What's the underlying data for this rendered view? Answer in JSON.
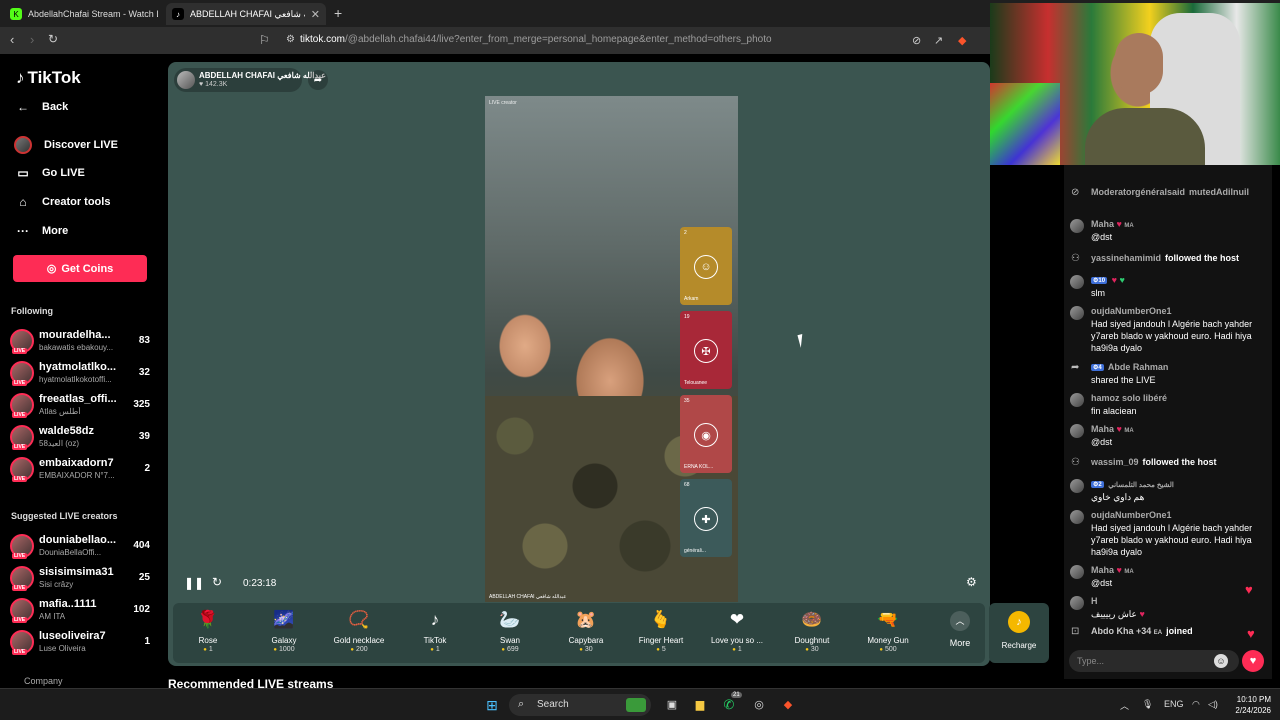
{
  "browser": {
    "tabs": [
      {
        "title": "AbdellahChafai Stream - Watch Live",
        "favicon": "kick-icon",
        "color": "#53fc18"
      },
      {
        "title": "ABDELLAH CHAFAI عبدالله شافعي",
        "favicon": "tiktok-icon",
        "color": "#111111"
      }
    ],
    "url_host": "tiktok.com",
    "url_rest": "/@abdellah.chafai44/live?enter_from_merge=personal_homepage&enter_method=others_photo"
  },
  "sidebar": {
    "logo": "TikTok",
    "nav": [
      {
        "label": "Back",
        "icon": "arrow-left-icon"
      },
      {
        "label": "Discover LIVE",
        "icon": "avatar"
      },
      {
        "label": "Go LIVE",
        "icon": "camera-icon"
      },
      {
        "label": "Creator tools",
        "icon": "home-icon"
      },
      {
        "label": "More",
        "icon": "ellipsis-icon"
      }
    ],
    "coins_button": "Get Coins",
    "following_heading": "Following",
    "following": [
      {
        "name": "mouradelha...",
        "sub": "bakawatis ebakouy...",
        "count": "83"
      },
      {
        "name": "hyatmolatlko...",
        "sub": "hyatmolatlkokotoffi...",
        "count": "32"
      },
      {
        "name": "freeatlas_offi...",
        "sub": "Atlas أطلس",
        "count": "325"
      },
      {
        "name": "walde58dz",
        "sub": "58العيد (oz)",
        "count": "39"
      },
      {
        "name": "embaixadorn7",
        "sub": "EMBAIXADOR N°7...",
        "count": "2"
      }
    ],
    "suggested_heading": "Suggested LIVE creators",
    "suggested": [
      {
        "name": "douniabellao...",
        "sub": "DouniaBellaOffi...",
        "count": "404"
      },
      {
        "name": "sisisimsima31",
        "sub": "Sisi crâzy",
        "count": "25"
      },
      {
        "name": "mafia..1111",
        "sub": "AM ITA",
        "count": "102"
      },
      {
        "name": "luseoliveira7",
        "sub": "Luse Oliveira",
        "count": "1"
      }
    ],
    "live_badge": "LIVE",
    "company": "Company"
  },
  "player": {
    "host_name": "ABDELLAH CHAFAI عبدالله شافعي",
    "host_likes": "142.3K",
    "video_label": "LIVE creator",
    "video_caption": "ABDELLAH CHAFAI عبدالله شافعي",
    "guests": [
      {
        "count": "2",
        "name": "Arkam",
        "color": "#b58b2a",
        "icon": "soldier-icon"
      },
      {
        "count": "19",
        "name": "Telouanee",
        "color": "#a82838",
        "icon": "shield-icon"
      },
      {
        "count": "35",
        "name": "ERNA KOL...",
        "color": "#b04848",
        "icon": "badge-icon"
      },
      {
        "count": "68",
        "name": "générali...",
        "color": "#3c5a5a",
        "icon": "flag-icon"
      }
    ],
    "elapsed": "0:23:18"
  },
  "gifts": [
    {
      "name": "Rose",
      "price": "1",
      "glyph": "🌹"
    },
    {
      "name": "Galaxy",
      "price": "1000",
      "glyph": "🌌"
    },
    {
      "name": "Gold necklace",
      "price": "200",
      "glyph": "📿"
    },
    {
      "name": "TikTok",
      "price": "1",
      "glyph": "♪"
    },
    {
      "name": "Swan",
      "price": "699",
      "glyph": "🦢"
    },
    {
      "name": "Capybara",
      "price": "30",
      "glyph": "🐹"
    },
    {
      "name": "Finger Heart",
      "price": "5",
      "glyph": "🫰"
    },
    {
      "name": "Love you so ...",
      "price": "1",
      "glyph": "❤"
    },
    {
      "name": "Doughnut",
      "price": "30",
      "glyph": "🍩"
    },
    {
      "name": "Money Gun",
      "price": "500",
      "glyph": "🔫"
    }
  ],
  "gifts_more": "More",
  "recharge": "Recharge",
  "recommended": "Recommended LIVE streams",
  "chat": {
    "messages": [
      {
        "name": "Moderatorgénéralsaid",
        "action": "mutedAdilnuil",
        "body": "",
        "kind": "system"
      },
      {
        "name": "Maha",
        "badge": "MA",
        "body": "@dst",
        "kind": "comment"
      },
      {
        "name": "yassinehamimid",
        "action": "followed the host",
        "body": "",
        "kind": "follow"
      },
      {
        "name": "",
        "badge": "10",
        "body": "slm",
        "kind": "comment"
      },
      {
        "name": "oujdaNumberOne1",
        "body": "Had siyed jandouh l Algérie bach yahder y7areb blado w yakhoud euro. Hadi hiya ha9i9a dyalo",
        "kind": "comment"
      },
      {
        "name": "Abde Rahman",
        "badge": "4",
        "body": "shared the LIVE",
        "kind": "share"
      },
      {
        "name": "hamoz solo libéré",
        "body": "fin alaciean",
        "kind": "comment"
      },
      {
        "name": "Maha",
        "badge": "MA",
        "body": "@dst",
        "kind": "comment"
      },
      {
        "name": "wassim_09",
        "action": "followed the host",
        "body": "",
        "kind": "follow"
      },
      {
        "name": "الشيخ محمد التلمساني",
        "badge": "2",
        "body": "هم داوي خاوي",
        "kind": "comment"
      },
      {
        "name": "oujdaNumberOne1",
        "body": "Had siyed jandouh l Algérie bach yahder y7areb blado w yakhoud euro. Hadi hiya ha9i9a dyalo",
        "kind": "comment"
      },
      {
        "name": "Maha",
        "badge": "MA",
        "body": "@dst",
        "kind": "comment"
      },
      {
        "name": "H",
        "body": "عاش رييييف",
        "kind": "comment"
      },
      {
        "name": "Abdo Kha +34",
        "badge": "EA",
        "action": "joined",
        "body": "",
        "kind": "join"
      }
    ],
    "input_placeholder": "Type..."
  },
  "taskbar": {
    "search": "Search",
    "lang": "ENG",
    "time": "10:10 PM",
    "date": "2/24/2026",
    "whatsapp_count": "21"
  }
}
